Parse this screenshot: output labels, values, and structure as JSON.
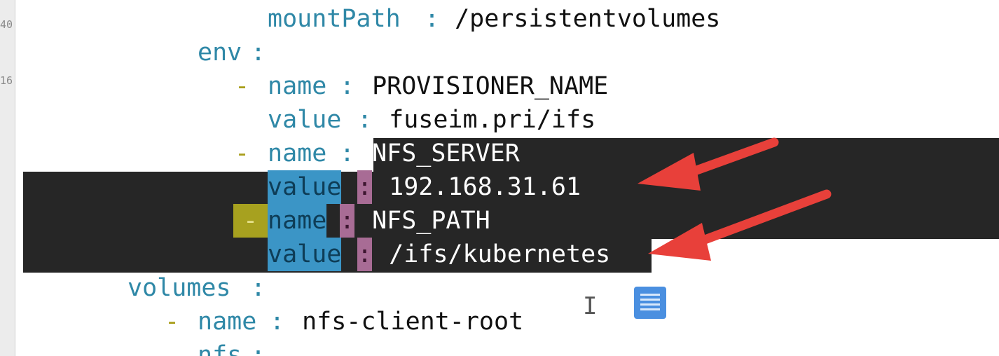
{
  "gutter": {
    "line_numbers": [
      "40",
      "16"
    ]
  },
  "code": {
    "lines": [
      {
        "key": "mountPath",
        "colon": ":",
        "value": " /persistentvolumes"
      },
      {
        "key": "env",
        "colon": ":"
      },
      {
        "dash": "-",
        "key": "name",
        "colon": ":",
        "value": " PROVISIONER_NAME"
      },
      {
        "key": "value",
        "colon": ":",
        "value": "  fuseim.pri/ifs"
      },
      {
        "dash": "-",
        "key": "name",
        "colon": ":",
        "value": " NFS_SERVER"
      },
      {
        "key": "value",
        "colon": ":",
        "value": "  192.168.31.61"
      },
      {
        "dash": "-",
        "key": "name",
        "colon": ":",
        "value": " NFS_PATH"
      },
      {
        "key": "value",
        "colon": ":",
        "value": "  /ifs/kubernetes"
      },
      {
        "key": "volumes",
        "colon": ":"
      },
      {
        "dash": "-",
        "key": "name",
        "colon": ":",
        "value": " nfs-client-root"
      },
      {
        "key": "nfs",
        "colon": ":"
      }
    ]
  },
  "annotations": {
    "arrow_color": "#e8403a",
    "arrows": [
      "arrow-to-nfs-server-ip",
      "arrow-to-nfs-path"
    ]
  },
  "icons": {
    "note": "note-icon",
    "cursor": "text-cursor-icon",
    "cursor_glyph": "I"
  }
}
